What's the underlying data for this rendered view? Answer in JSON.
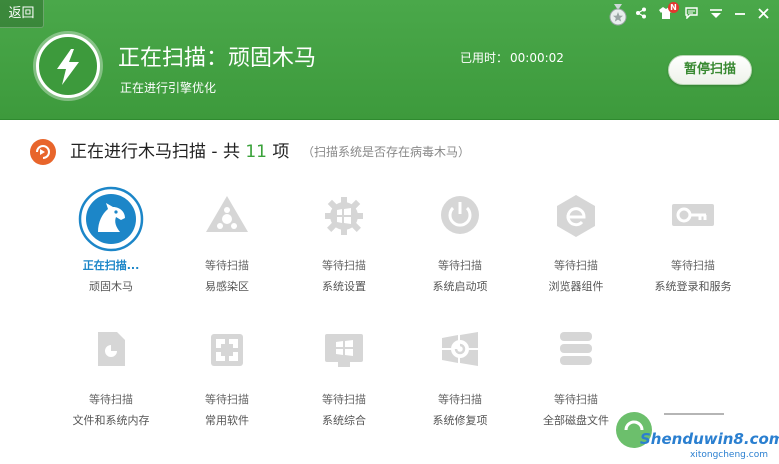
{
  "window": {
    "back_label": "返回"
  },
  "header": {
    "title": "正在扫描：顽固木马",
    "subtitle": "正在进行引擎优化",
    "elapsed_label": "已用时：",
    "elapsed_value": "00:00:02",
    "pause_label": "暂停扫描",
    "notification_badge": "N",
    "colors": {
      "background": "#3d9a3c",
      "accent": "#3a8a33"
    }
  },
  "section": {
    "title_prefix": "正在进行木马扫描 - 共",
    "count": "11",
    "title_suffix": "项",
    "note": "（扫描系统是否存在病毒木马）"
  },
  "items": [
    {
      "status": "正在扫描...",
      "name": "顽固木马",
      "icon": "horse-icon",
      "active": true
    },
    {
      "status": "等待扫描",
      "name": "易感染区",
      "icon": "danger-zone-icon"
    },
    {
      "status": "等待扫描",
      "name": "系统设置",
      "icon": "settings-gear-icon"
    },
    {
      "status": "等待扫描",
      "name": "系统启动项",
      "icon": "power-icon"
    },
    {
      "status": "等待扫描",
      "name": "浏览器组件",
      "icon": "browser-icon"
    },
    {
      "status": "等待扫描",
      "name": "系统登录和服务",
      "icon": "login-key-icon"
    },
    {
      "status": "等待扫描",
      "name": "文件和系统内存",
      "icon": "file-memory-icon"
    },
    {
      "status": "等待扫描",
      "name": "常用软件",
      "icon": "software-icon"
    },
    {
      "status": "等待扫描",
      "name": "系统综合",
      "icon": "windows-monitor-icon"
    },
    {
      "status": "等待扫描",
      "name": "系统修复项",
      "icon": "repair-icon"
    },
    {
      "status": "等待扫描",
      "name": "全部磁盘文件",
      "icon": "disk-stack-icon"
    }
  ],
  "watermark": {
    "line1": "Shenduwin8.com",
    "line2": "xitongcheng.com"
  }
}
